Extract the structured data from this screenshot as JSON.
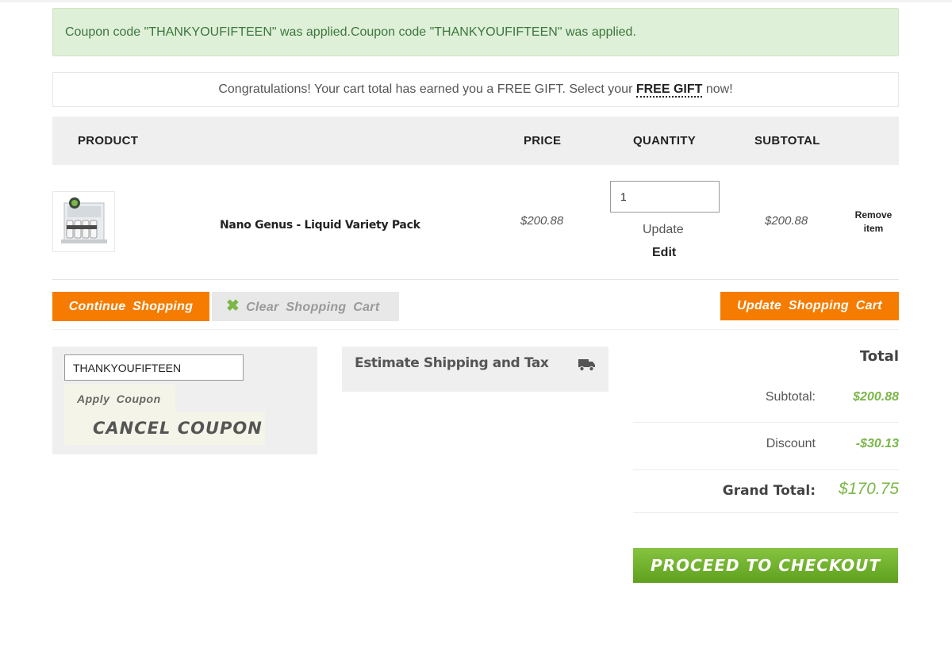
{
  "messages": {
    "success": "Coupon code \"THANKYOUFIFTEEN\" was applied.Coupon code \"THANKYOUFIFTEEN\" was applied."
  },
  "gift_banner": {
    "prefix": "Congratulations! Your cart total has earned you a FREE GIFT. Select your ",
    "link": "FREE GIFT",
    "suffix": " now!"
  },
  "table": {
    "headers": {
      "product": "PRODUCT",
      "price": "PRICE",
      "quantity": "QUANTITY",
      "subtotal": "SUBTOTAL"
    },
    "items": [
      {
        "name": "Nano Genus - Liquid Variety Pack",
        "price": "$200.88",
        "qty": "1",
        "update_label": "Update",
        "edit_label": "Edit",
        "subtotal": "$200.88",
        "remove_label": "Remove item"
      }
    ]
  },
  "actions": {
    "continue_label": "Continue Shopping",
    "clear_label": "Clear Shopping Cart",
    "update_label": "Update Shopping Cart"
  },
  "coupon": {
    "value": "THANKYOUFIFTEEN",
    "apply_label": "Apply Coupon",
    "cancel_label": "CANCEL COUPON"
  },
  "shipping": {
    "title": "Estimate Shipping and Tax"
  },
  "totals": {
    "title": "Total",
    "subtotal_label": "Subtotal:",
    "subtotal_value": "$200.88",
    "discount_label": "Discount",
    "discount_value": "-$30.13",
    "grand_label": "Grand Total:",
    "grand_value": "$170.75"
  },
  "checkout": {
    "label": "PROCEED TO CHECKOUT"
  },
  "colors": {
    "accent_orange": "#f57c00",
    "accent_green": "#7ab648",
    "success_bg": "#dff0d8",
    "success_text": "#3c763d"
  },
  "icons": {
    "clear": "close-icon",
    "shipping": "truck-icon"
  }
}
